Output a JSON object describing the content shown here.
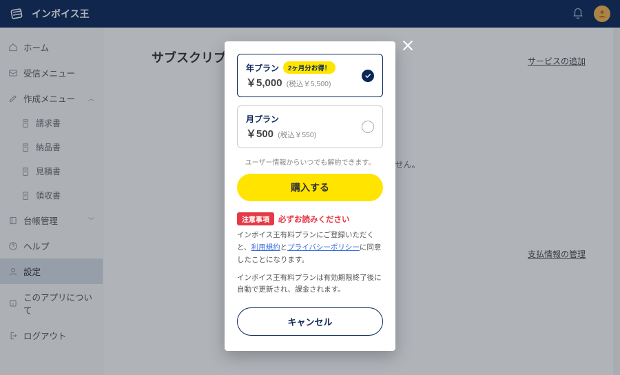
{
  "header": {
    "brand": "インボイス王"
  },
  "sidebar": {
    "items": [
      {
        "label": "ホーム",
        "icon": "home"
      },
      {
        "label": "受信メニュー",
        "icon": "inbox"
      },
      {
        "label": "作成メニュー",
        "icon": "edit",
        "expandable": true,
        "expanded": true
      },
      {
        "label": "請求書",
        "icon": "doc",
        "sub": true
      },
      {
        "label": "納品書",
        "icon": "doc",
        "sub": true
      },
      {
        "label": "見積書",
        "icon": "doc",
        "sub": true
      },
      {
        "label": "領収書",
        "icon": "doc",
        "sub": true
      },
      {
        "label": "台帳管理",
        "icon": "book",
        "expandable": true,
        "expanded": false
      },
      {
        "label": "ヘルプ",
        "icon": "help"
      },
      {
        "label": "設定",
        "icon": "user",
        "active": true
      },
      {
        "label": "このアプリについて",
        "icon": "info"
      },
      {
        "label": "ログアウト",
        "icon": "logout"
      }
    ]
  },
  "main": {
    "title": "サブスクリプション",
    "add_service": "サービスの追加",
    "bg_note": "りません。",
    "payment_link": "支払情報の管理"
  },
  "modal": {
    "plans": {
      "yearly": {
        "name": "年プラン",
        "badge": "2ヶ月分お得！",
        "price": "￥5,000",
        "tax": "(税込￥5,500)",
        "selected": true
      },
      "monthly": {
        "name": "月プラン",
        "price": "￥500",
        "tax": "(税込￥550)",
        "selected": false
      }
    },
    "mini_note": "ユーザー情報からいつでも解約できます。",
    "buy_label": "購入する",
    "warn_chip": "注意事項",
    "warn_text": "必ずお読みください",
    "legal_pre": "インボイス王有料プランにご登録いただくと、",
    "terms": "利用規約",
    "and": "と",
    "privacy": "プライバシーポリシー",
    "legal_post": "に同意したことになります。",
    "renew_note": "インボイス王有料プランは有効期限終了後に自動で更新され、課金されます。",
    "cancel_label": "キャンセル"
  }
}
